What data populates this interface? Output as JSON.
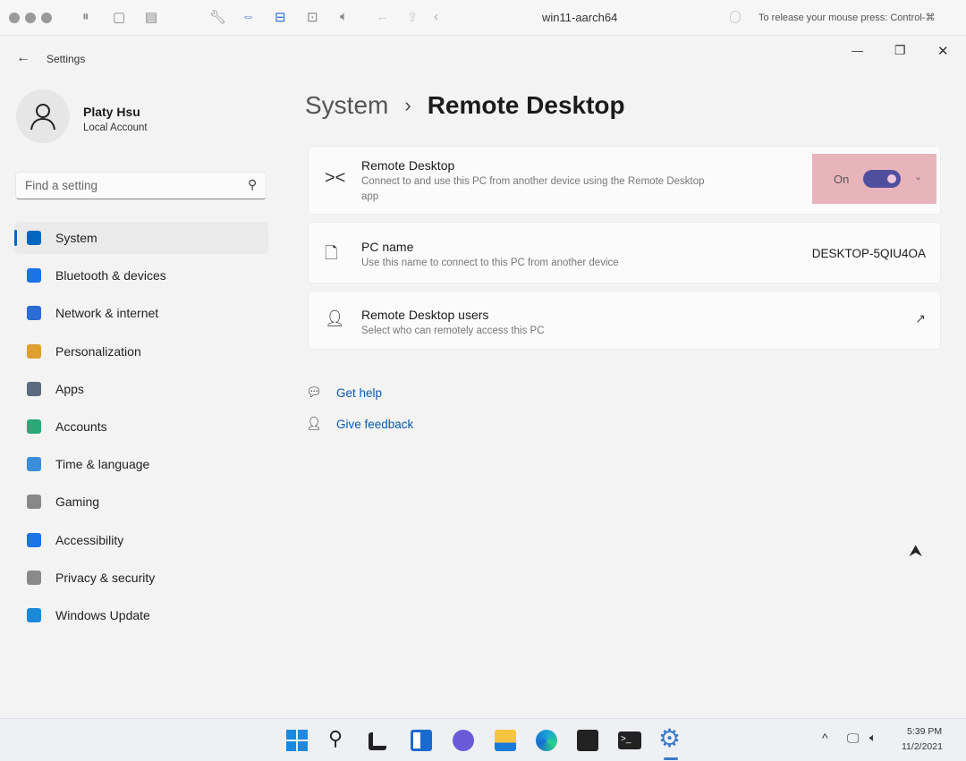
{
  "host": {
    "vm_title": "win11-aarch64",
    "release_hint": "To release your mouse press: Control-⌘"
  },
  "window": {
    "app_title": "Settings",
    "minimize": "—",
    "maximize": "❐",
    "close": "✕"
  },
  "user": {
    "name": "Platy Hsu",
    "account_type": "Local Account"
  },
  "search": {
    "placeholder": "Find a setting"
  },
  "sidebar": {
    "items": [
      {
        "label": "System",
        "color": "#0067c0"
      },
      {
        "label": "Bluetooth & devices",
        "color": "#1a73e8"
      },
      {
        "label": "Network & internet",
        "color": "#2b6cd6"
      },
      {
        "label": "Personalization",
        "color": "#e0a030"
      },
      {
        "label": "Apps",
        "color": "#5a6a80"
      },
      {
        "label": "Accounts",
        "color": "#2aa876"
      },
      {
        "label": "Time & language",
        "color": "#3a8ed8"
      },
      {
        "label": "Gaming",
        "color": "#888888"
      },
      {
        "label": "Accessibility",
        "color": "#1a73e8"
      },
      {
        "label": "Privacy & security",
        "color": "#8a8a8a"
      },
      {
        "label": "Windows Update",
        "color": "#1a8ad8"
      }
    ]
  },
  "breadcrumb": {
    "parent": "System",
    "separator": "›",
    "current": "Remote Desktop"
  },
  "cards": {
    "remote_desktop": {
      "title": "Remote Desktop",
      "desc": "Connect to and use this PC from another device using the Remote Desktop app",
      "state": "On"
    },
    "pc_name": {
      "title": "PC name",
      "desc": "Use this name to connect to this PC from another device",
      "value": "DESKTOP-5QIU4OA"
    },
    "users": {
      "title": "Remote Desktop users",
      "desc": "Select who can remotely access this PC"
    }
  },
  "links": {
    "help": "Get help",
    "feedback": "Give feedback"
  },
  "taskbar": {
    "time": "5:39 PM",
    "date": "11/2/2021"
  },
  "colors": {
    "accent": "#0067c0",
    "toggle": "#4f4f9e",
    "highlight": "#e8b4bb"
  }
}
